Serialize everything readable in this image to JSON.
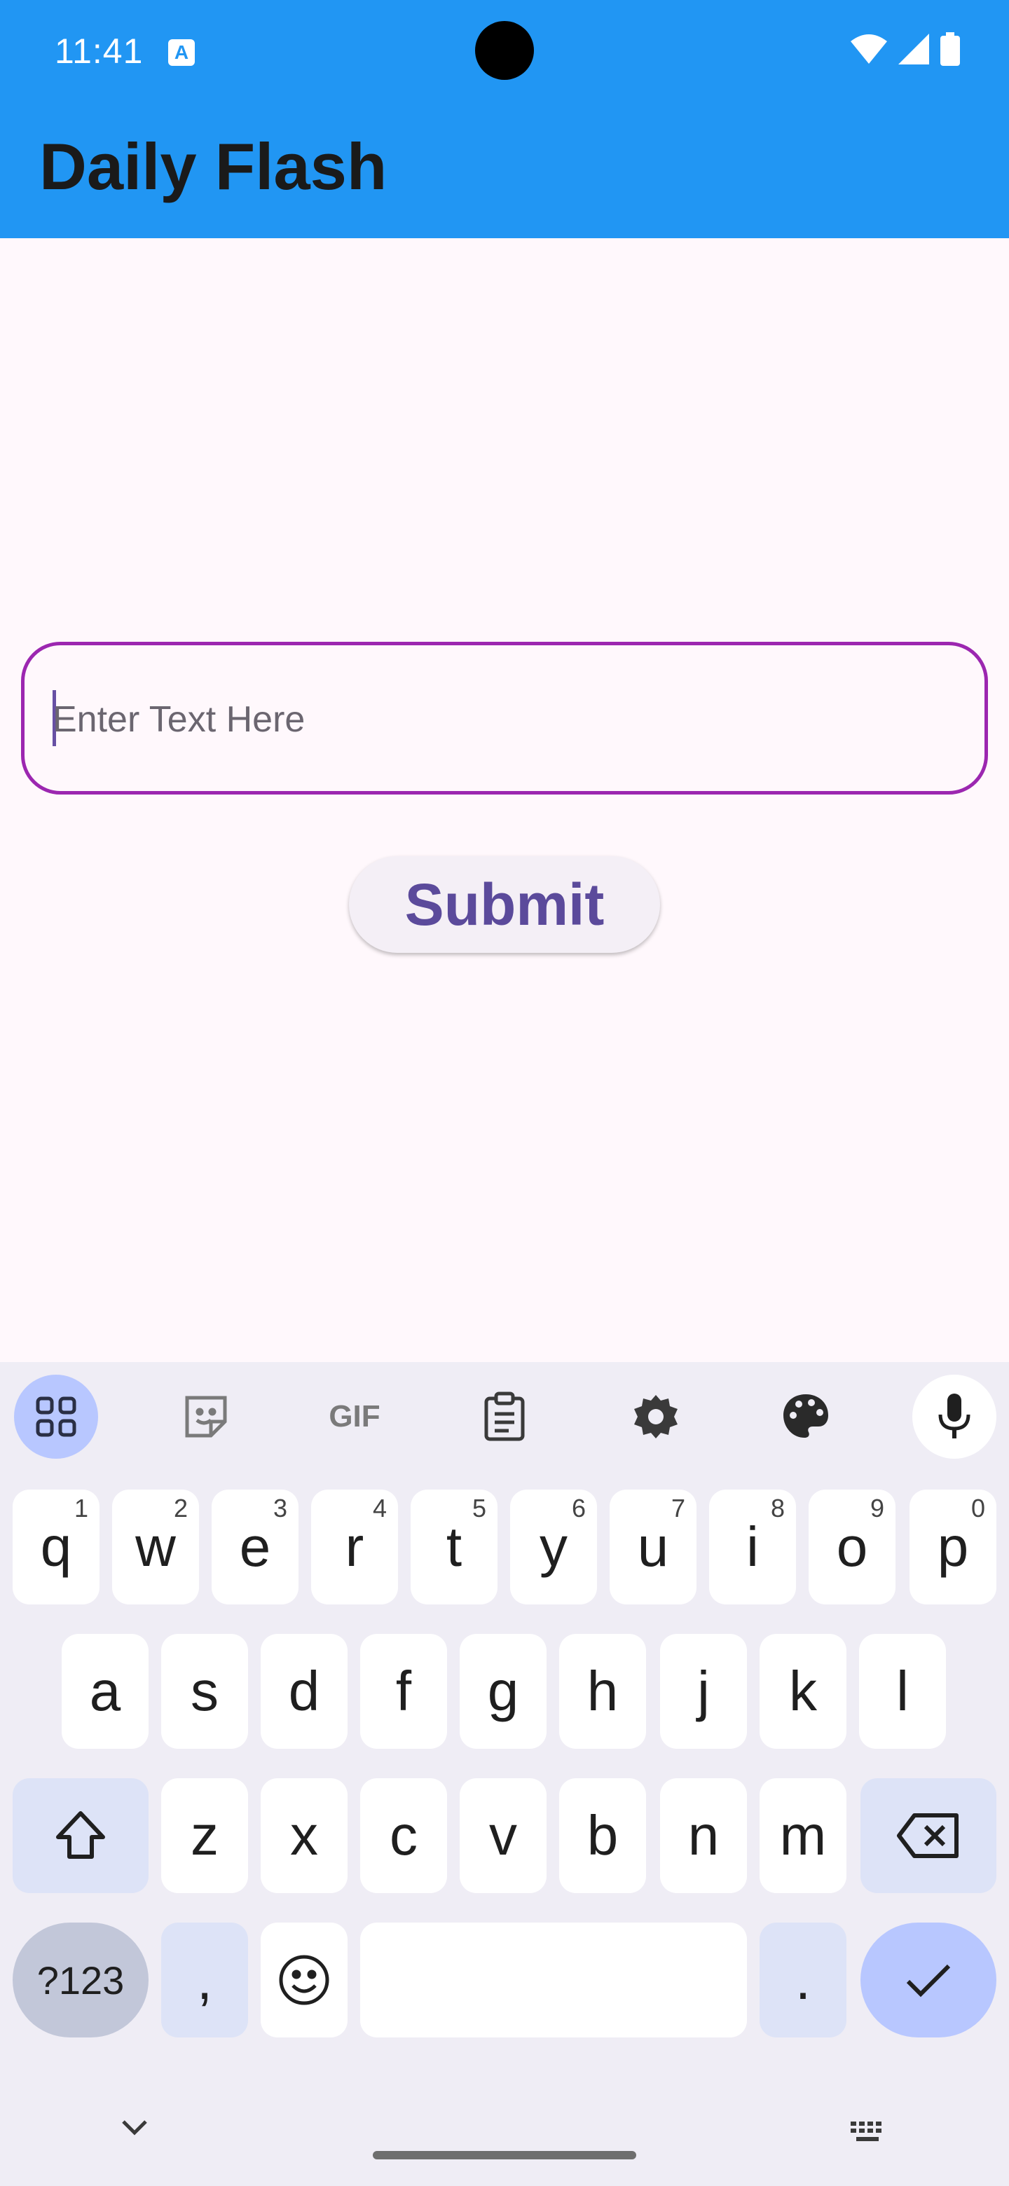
{
  "status_bar": {
    "time": "11:41",
    "notification_icon": "A"
  },
  "app_bar": {
    "title": "Daily Flash"
  },
  "form": {
    "text_field_placeholder": "Enter Text Here",
    "submit_label": "Submit"
  },
  "keyboard": {
    "toolbar": [
      "apps-icon",
      "sticker-icon",
      "gif-icon",
      "clipboard-icon",
      "settings-icon",
      "palette-icon",
      "mic-icon"
    ],
    "gif_label": "GIF",
    "row1": [
      {
        "key": "q",
        "num": "1"
      },
      {
        "key": "w",
        "num": "2"
      },
      {
        "key": "e",
        "num": "3"
      },
      {
        "key": "r",
        "num": "4"
      },
      {
        "key": "t",
        "num": "5"
      },
      {
        "key": "y",
        "num": "6"
      },
      {
        "key": "u",
        "num": "7"
      },
      {
        "key": "i",
        "num": "8"
      },
      {
        "key": "o",
        "num": "9"
      },
      {
        "key": "p",
        "num": "0"
      }
    ],
    "row2": [
      "a",
      "s",
      "d",
      "f",
      "g",
      "h",
      "j",
      "k",
      "l"
    ],
    "row3": [
      "z",
      "x",
      "c",
      "v",
      "b",
      "n",
      "m"
    ],
    "symbols_label": "?123",
    "comma_label": ",",
    "period_label": "."
  },
  "colors": {
    "app_bar": "#2196f3",
    "field_border": "#9c27b0",
    "submit_text": "#5b4a9b",
    "keyboard_bg": "#efedf5"
  }
}
